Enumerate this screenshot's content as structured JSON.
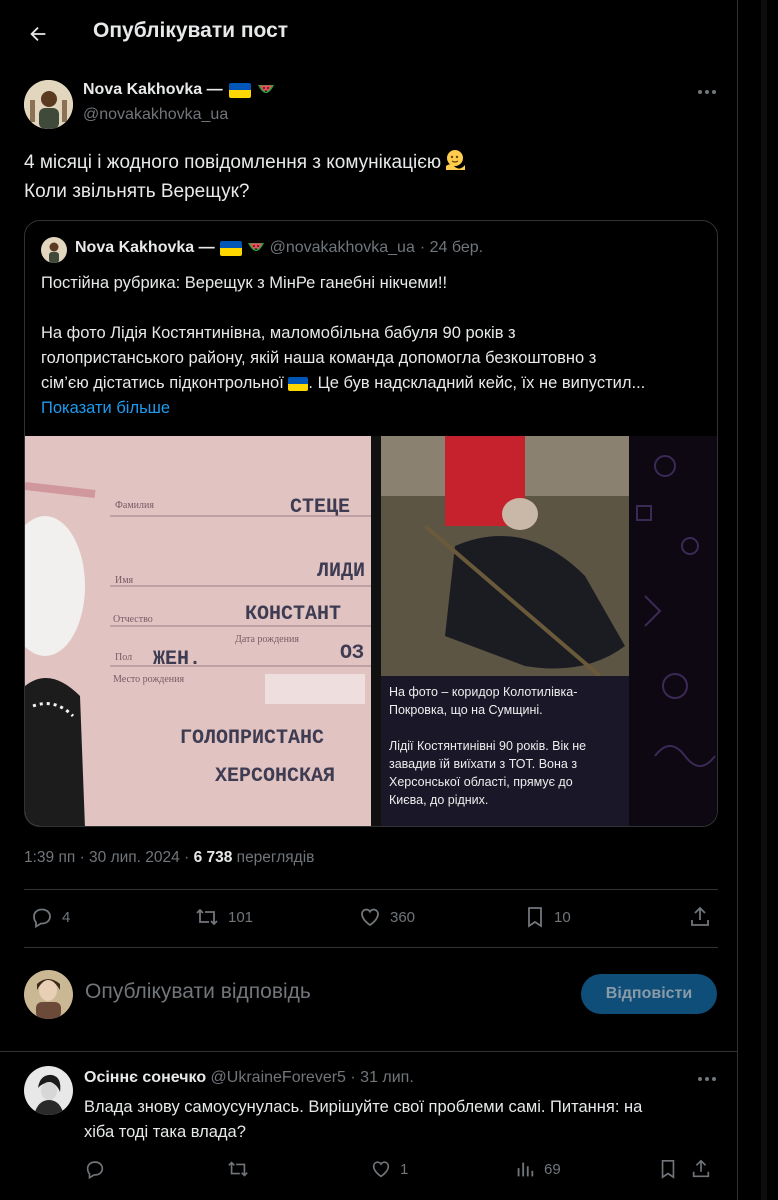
{
  "header": {
    "title": "Опублікувати пост"
  },
  "author": {
    "name": "Nova Kakhovka —",
    "handle": "@novakakhovka_ua"
  },
  "tweet": {
    "lines": [
      "4 місяці і жодного повідомлення з комунікацією",
      "Коли звільнять Верещук?"
    ]
  },
  "quote": {
    "name": "Nova Kakhovka —",
    "handle": "@novakakhovka_ua",
    "date": "· 24 бер.",
    "lines": [
      "Постійна рубрика: Верещук з МінРе ганебні нікчеми!!",
      "",
      "На фото Лідія Костянтинівна, маломобільна бабуля 90 років з",
      "голопристанського району, якій наша команда допомогла безкоштовно з",
      "сім’єю дістатись підконтрольної",
      "Показати більше"
    ],
    "line5_after_flag": ". Це був надскладний кейс, їх не випустил...",
    "passport": {
      "label_surname": "Фамилия",
      "value_surname": "СТЕЦЕ",
      "label_name": "Имя",
      "value_name": "ЛИДИ",
      "label_patronymic": "Отчество",
      "value_patronymic": "КОНСТАНТ",
      "label_sex": "Пол",
      "value_sex": "ЖЕН.",
      "label_dob": "Дата рождения",
      "value_dob": "ОЗ",
      "label_birthplace": "Место рождения",
      "value_place1": "ГОЛОПРИСТАНС",
      "value_place2": "ХЕРСОНСКАЯ"
    },
    "caption": [
      "На фото – коридор Колотилівка-",
      "Покровка, що на Сумщині.",
      "",
      "Лідії Костянтинівні 90 років. Вік не",
      "завадив їй виїхати з ТОТ. Вона з",
      "Херсонської області, прямує до",
      "Києва, до рідних."
    ]
  },
  "meta": {
    "time": "1:39 пп · 30 лип. 2024 ·",
    "views": "6 738",
    "views_label": "переглядів"
  },
  "actions": {
    "replies": "4",
    "reposts": "101",
    "likes": "360",
    "bookmarks": "10"
  },
  "reply": {
    "placeholder": "Опублікувати відповідь",
    "button": "Відповісти"
  },
  "comment": {
    "name": "Осіннє сонечко",
    "handle_date": "@UkraineForever5 · 31 лип.",
    "lines": [
      "Влада знову самоусунулась. Вирішуйте свої проблеми самі. Питання: на",
      "хіба тоді така влада?"
    ],
    "likes": "1",
    "views": "69"
  },
  "colors": {
    "background": "#000000",
    "text": "#e7e9ea",
    "muted": "#71767b",
    "accent": "#1d9bf0",
    "border": "#2f3336"
  },
  "icons": [
    "back-arrow-icon",
    "more-icon",
    "reply-icon",
    "repost-icon",
    "like-icon",
    "bookmark-icon",
    "share-icon",
    "views-icon"
  ]
}
